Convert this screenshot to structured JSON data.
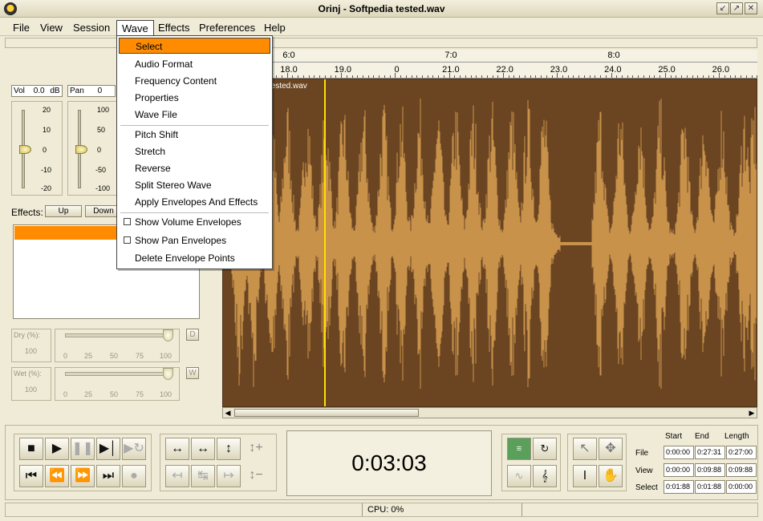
{
  "window": {
    "title": "Orinj - Softpedia tested.wav"
  },
  "menubar": [
    "File",
    "View",
    "Session",
    "Wave",
    "Effects",
    "Preferences",
    "Help"
  ],
  "wave_menu": {
    "groups": [
      [
        "Select",
        "Audio Format",
        "Frequency Content",
        "Properties",
        "Wave File"
      ],
      [
        "Pitch Shift",
        "Stretch",
        "Reverse",
        "Split Stereo Wave",
        "Apply Envelopes And Effects"
      ],
      [
        "Show Volume Envelopes",
        "Show Pan Envelopes",
        "Delete Envelope Points"
      ]
    ],
    "highlighted": "Select"
  },
  "ruler": {
    "major": [
      "6:0",
      "7:0",
      "8:0"
    ],
    "minor": [
      "18.0",
      "19.0",
      "0",
      "21.0",
      "22.0",
      "23.0",
      "24.0",
      "25.0",
      "26.0"
    ]
  },
  "wave": {
    "name_fragment": "tested.wav",
    "color": "#c8924a",
    "background": "#6b4522",
    "cursor_color": "#ffe000"
  },
  "mixer": {
    "vol": {
      "label": "Vol",
      "value": "0.0",
      "unit": "dB",
      "scale": [
        "20",
        "10",
        "0",
        "-10",
        "-20"
      ]
    },
    "pan": {
      "label": "Pan",
      "value": "0",
      "scale": [
        "100",
        "50",
        "0",
        "-50",
        "-100"
      ]
    }
  },
  "effects": {
    "label": "Effects:",
    "up": "Up",
    "down": "Down"
  },
  "dry": {
    "label": "Dry (%):",
    "value": "100",
    "scale": [
      "0",
      "25",
      "50",
      "75",
      "100"
    ],
    "button": "D"
  },
  "wet": {
    "label": "Wet (%):",
    "value": "100",
    "scale": [
      "0",
      "25",
      "50",
      "75",
      "100"
    ],
    "button": "W"
  },
  "time_display": "0:03:03",
  "position_grid": {
    "headers": [
      "Start",
      "End",
      "Length"
    ],
    "rows": [
      {
        "label": "File",
        "values": [
          "0:00:00",
          "0:27:31",
          "0:27:00"
        ]
      },
      {
        "label": "View",
        "values": [
          "0:00:00",
          "0:09:88",
          "0:09:88"
        ]
      },
      {
        "label": "Select",
        "values": [
          "0:01:88",
          "0:01:88",
          "0:00:00"
        ]
      }
    ]
  },
  "status": {
    "cpu": "CPU: 0%"
  }
}
